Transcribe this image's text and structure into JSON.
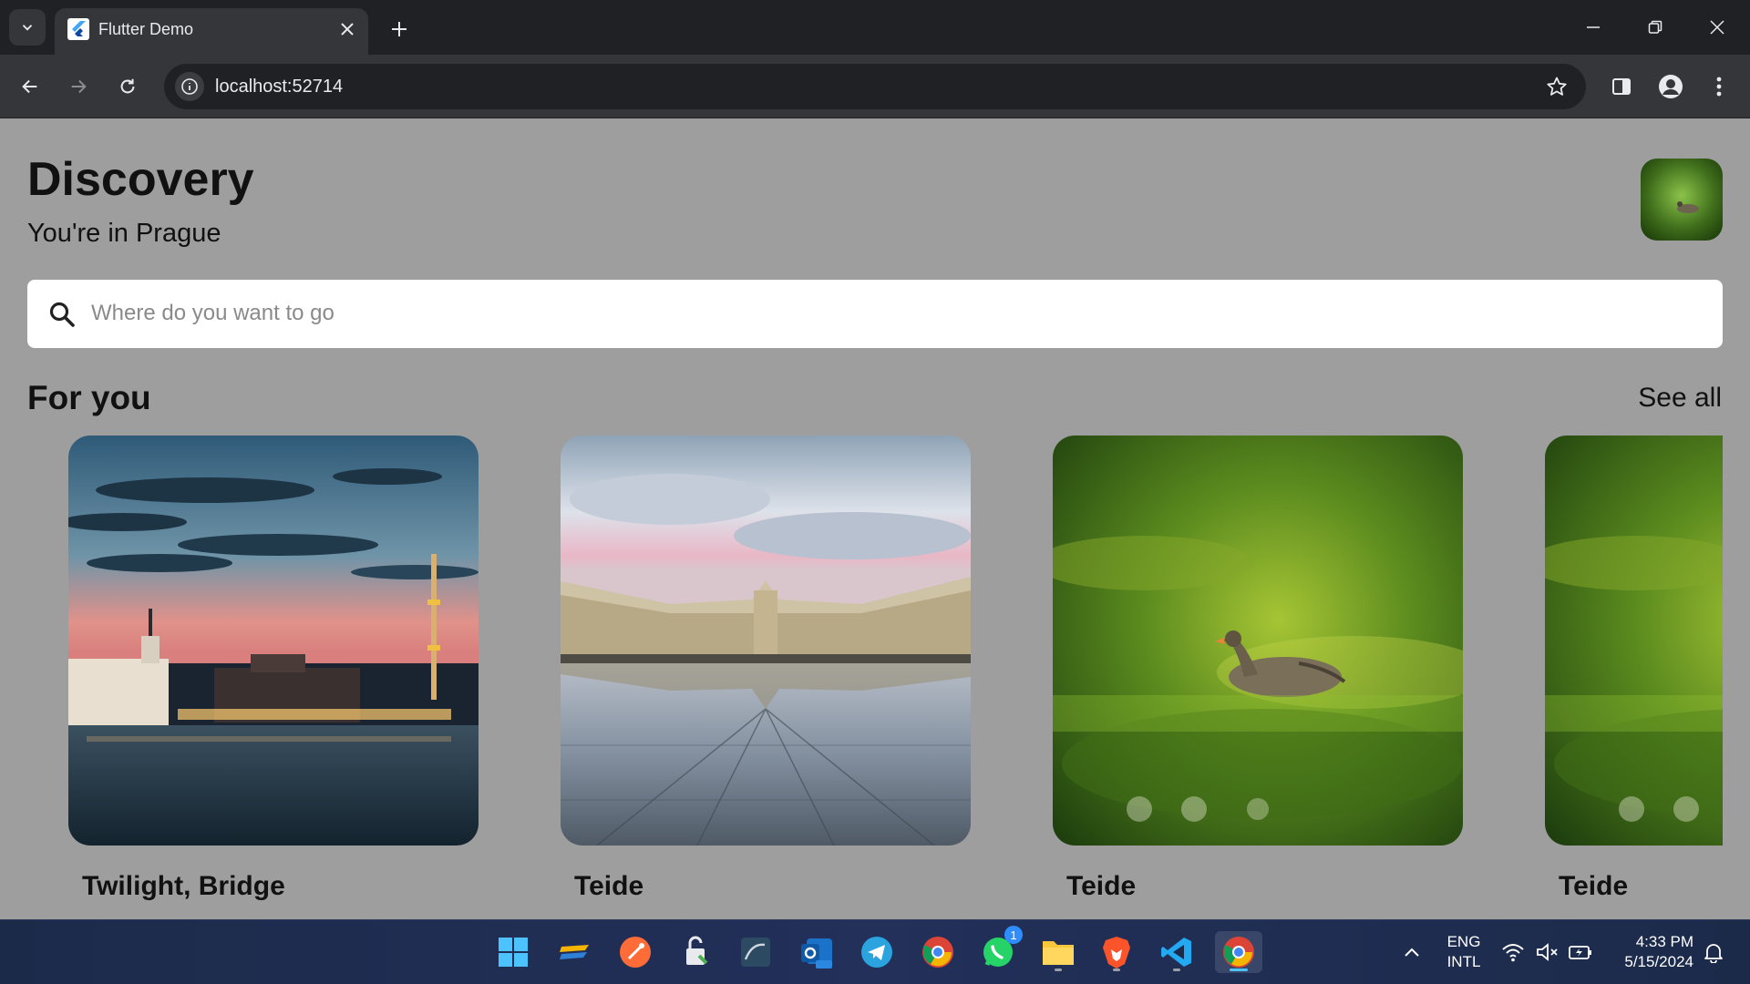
{
  "browser": {
    "tab_title": "Flutter Demo",
    "url": "localhost:52714"
  },
  "app": {
    "title": "Discovery",
    "subtitle": "You're in Prague",
    "search_placeholder": "Where do you want to go",
    "section_title": "For you",
    "see_all_label": "See all",
    "cards": [
      {
        "label": "Twilight, Bridge",
        "image": "city-twilight-skyline"
      },
      {
        "label": "Teide",
        "image": "palace-water-mirror"
      },
      {
        "label": "Teide",
        "image": "goose-in-grass"
      },
      {
        "label": "Teide",
        "image": "goose-in-grass"
      }
    ]
  },
  "taskbar": {
    "language_line1": "ENG",
    "language_line2": "INTL",
    "time": "4:33 PM",
    "date": "5/15/2024",
    "whatsapp_badge": "1"
  },
  "colors": {
    "page_background": "#9e9e9e",
    "chrome_dark": "#202124",
    "chrome_toolbar": "#35363a",
    "accent": "#4cc2ff"
  }
}
